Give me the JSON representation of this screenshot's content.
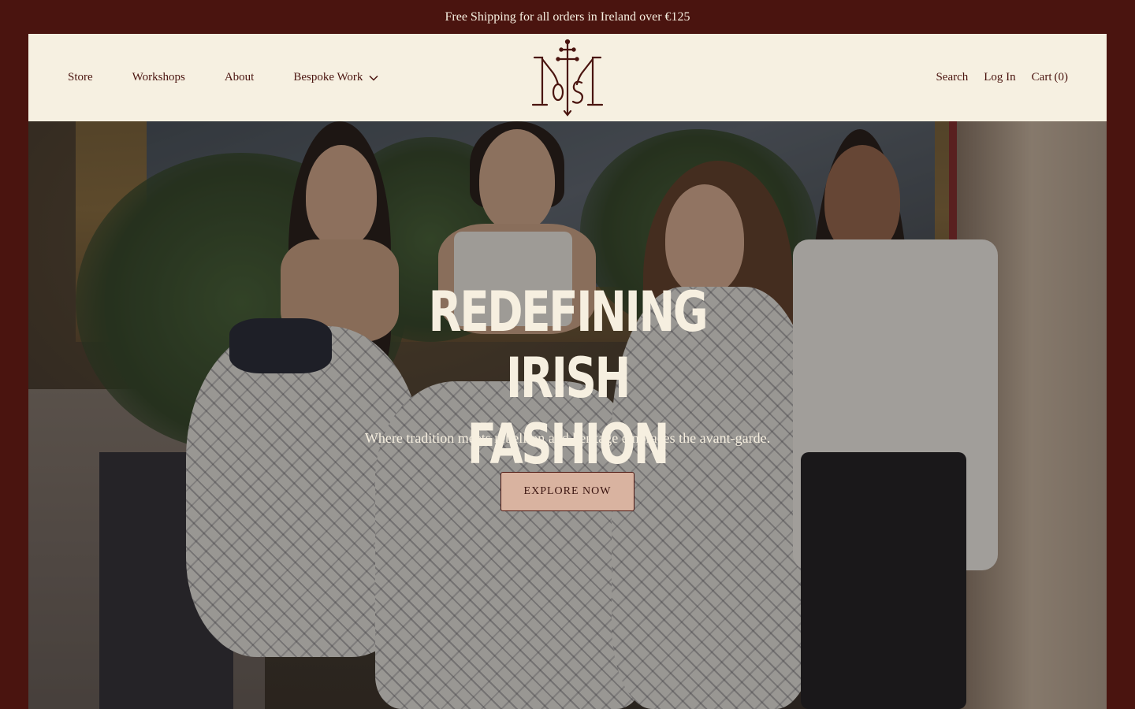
{
  "announcement": {
    "text": "Free Shipping for all orders in Ireland over €125"
  },
  "header": {
    "nav_left": [
      {
        "label": "Store"
      },
      {
        "label": "Workshops"
      },
      {
        "label": "About"
      },
      {
        "label": "Bespoke Work"
      }
    ],
    "nav_right": {
      "search": "Search",
      "login": "Log In",
      "cart": "Cart",
      "cart_count": "(0)"
    },
    "logo_icon": "monogram-cross-logo"
  },
  "hero": {
    "title_line1": "REDEFINING IRISH",
    "title_line2": "FASHION",
    "subtitle": "Where tradition meets rebellion and heritage embraces the avant-garde.",
    "cta": "EXPLORE NOW"
  },
  "colors": {
    "brand_dark": "#4a140f",
    "header_bg": "#f6f0e1",
    "cta_bg": "#d9b3a0",
    "light_text": "#f6efe0"
  }
}
